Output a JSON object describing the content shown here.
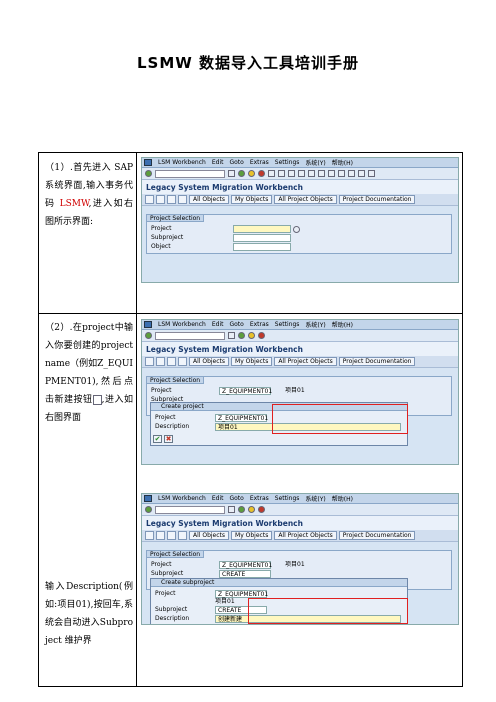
{
  "title": "LSMW 数据导入工具培训手册",
  "steps": [
    {
      "text_a": "（1）.首先进入 SAP 系统界面,输入事务代码 ",
      "tcode": "LSMW",
      "text_b": ",进入如右图所示界面:"
    },
    {
      "text_a": "（2）.在project中输入你要创建的project name（例如Z_EQUIPMENT01),然后点击新建按钮",
      "text_b": ",进入如右图界面"
    },
    {
      "text_a": "输入Description(例如:项目01),按回车,系统会自动进入Subproject 维护界"
    }
  ],
  "sap": {
    "menu": [
      "LSM Workbench",
      "Edit",
      "Goto",
      "Extras",
      "Settings",
      "系统(Y)",
      "帮助(H)"
    ],
    "app_title": "Legacy System Migration Workbench",
    "buttons": [
      "All Objects",
      "My Objects",
      "All Project Objects",
      "Project Documentation"
    ],
    "group_title": "Project Selection",
    "labels": {
      "project": "Project",
      "subproject": "Subproject",
      "object": "Object",
      "description": "Description"
    },
    "values": {
      "project": "Z_EQUIPMENT01",
      "project_desc": "项目01",
      "subproject": "CREATE",
      "subproject_desc": "创建新建"
    },
    "dialogs": {
      "create_project": "Create project",
      "create_subproject": "Create subproject"
    }
  }
}
